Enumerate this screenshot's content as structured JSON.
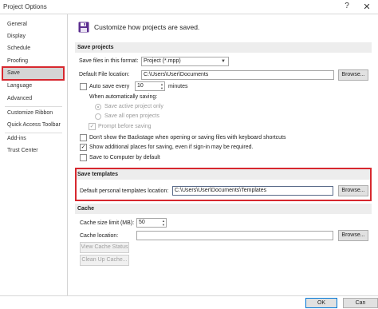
{
  "window": {
    "title": "Project Options",
    "help_label": "?",
    "close_label": "✕"
  },
  "sidebar": {
    "items": [
      {
        "label": "General"
      },
      {
        "label": "Display"
      },
      {
        "label": "Schedule"
      },
      {
        "label": "Proofing"
      },
      {
        "label": "Save"
      },
      {
        "label": "Language"
      },
      {
        "label": "Advanced"
      },
      {
        "label": "Customize Ribbon"
      },
      {
        "label": "Quick Access Toolbar"
      },
      {
        "label": "Add-ins"
      },
      {
        "label": "Trust Center"
      }
    ]
  },
  "header": {
    "text": "Customize how projects are saved.",
    "icon": "floppy-disk-icon"
  },
  "save_projects": {
    "title": "Save projects",
    "format_label": "Save files in this format:",
    "format_value": "Project (*.mpp)",
    "default_location_label": "Default File location:",
    "default_location_value": "C:\\Users\\User\\Documents",
    "browse_label": "Browse...",
    "autosave_label": "Auto save every",
    "autosave_value": "10",
    "autosave_unit": "minutes",
    "when_autosaving_label": "When automatically saving:",
    "save_active_label": "Save active project only",
    "save_all_label": "Save all open projects",
    "prompt_label": "Prompt before saving",
    "no_backstage_label": "Don't show the Backstage when opening or saving files with keyboard shortcuts",
    "show_additional_label": "Show additional places for saving, even if sign-in may be required.",
    "save_to_computer_label": "Save to Computer by default",
    "check_mark": "✓"
  },
  "save_templates": {
    "title": "Save templates",
    "location_label": "Default personal templates location:",
    "location_value": "C:\\Users\\User\\Documents\\Templates",
    "browse_label": "Browse..."
  },
  "cache": {
    "title": "Cache",
    "size_label": "Cache size limit (MB):",
    "size_value": "50",
    "location_label": "Cache location:",
    "location_value": "",
    "browse_label": "Browse...",
    "view_status_label": "View Cache Status",
    "clean_up_label": "Clean Up Cache..."
  },
  "footer": {
    "ok_label": "OK",
    "cancel_label": "Can"
  },
  "colors": {
    "highlight": "#d7282f",
    "section_bg": "#ededed",
    "selected_nav": "#d5d5d5"
  }
}
